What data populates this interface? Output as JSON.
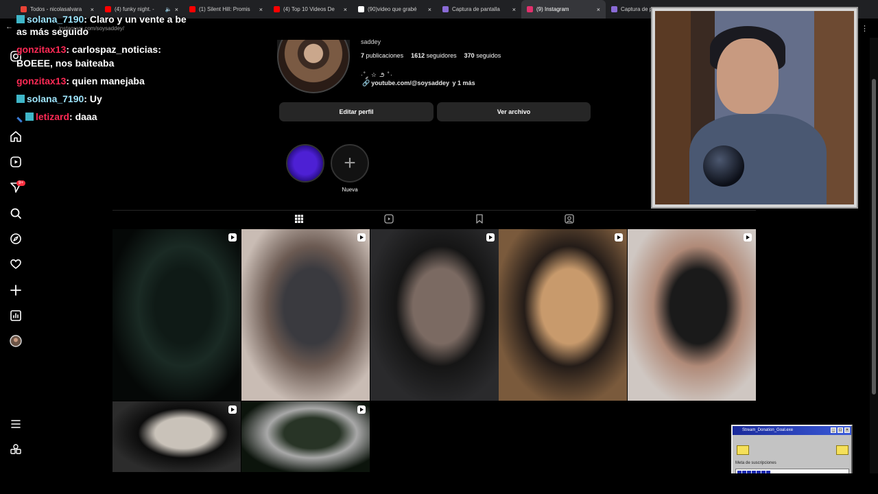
{
  "browser": {
    "tabs": [
      {
        "title": "Todos - nicolasalvara",
        "favicon_color": "#ea4335",
        "active": false
      },
      {
        "title": "(4) funky night. -",
        "favicon_color": "#ff0000",
        "active": false,
        "muted": true
      },
      {
        "title": "(1) Silent Hill: Promis",
        "favicon_color": "#ff0000",
        "active": false
      },
      {
        "title": "(4) Top 10 Videos De",
        "favicon_color": "#ff0000",
        "active": false
      },
      {
        "title": "(90)video que grabé",
        "favicon_color": "#ffffff",
        "active": false
      },
      {
        "title": "Captura de pantalla",
        "favicon_color": "#8a6bd6",
        "active": false
      },
      {
        "title": "(9) Instagram",
        "favicon_color": "#e1306c",
        "active": true
      },
      {
        "title": "Captura de pa",
        "favicon_color": "#8a6bd6",
        "active": false
      }
    ],
    "url": "instagram.com/soysaddey/"
  },
  "chat": {
    "lines": [
      {
        "user": "solana_7190",
        "text": "Claro y un vente a be",
        "user_color": "#9fe6ff"
      },
      {
        "user": "",
        "text": "as más seguido"
      },
      {
        "user": "gonzitax13",
        "text": "carlospaz_noticias:",
        "user_color": "#ff2a55"
      },
      {
        "user": "",
        "text": "BOEEE, nos baiteaba"
      },
      {
        "user": "gonzitax13",
        "text": "quien manejaba",
        "user_color": "#ff2a55"
      },
      {
        "user": "solana_7190",
        "text": "Uy",
        "user_color": "#9fe6ff"
      },
      {
        "user": "letizard",
        "text": "daaa",
        "user_color": "#ff2a55"
      }
    ]
  },
  "sidebar": {
    "badge": "9+",
    "items": [
      "home-icon",
      "reels-icon",
      "messages-icon",
      "search-icon",
      "explore-icon",
      "notifications-icon",
      "create-icon",
      "insights-icon",
      "profile-icon"
    ],
    "bottom": [
      "more-icon",
      "threads-icon"
    ]
  },
  "profile": {
    "username": "saddey",
    "posts_count": "7",
    "posts_label": "publicaciones",
    "followers_count": "1612",
    "followers_label": "seguidores",
    "following_count": "370",
    "following_label": "seguidos",
    "bio": "·˚ ༘ ☆ ౨ ˚·",
    "link_text": "youtube.com/@soysaddey",
    "link_more": "y 1 más",
    "edit_button": "Editar perfil",
    "archive_button": "Ver archivo"
  },
  "highlights": [
    {
      "label": "",
      "color": "#4d20d4"
    },
    {
      "label": "Nueva",
      "is_new": true
    }
  ],
  "profile_tabs": [
    "posts-grid-icon",
    "reels-icon",
    "saved-icon",
    "tagged-icon"
  ],
  "grid": {
    "tiles": [
      {
        "kind": "reel",
        "palette": [
          "#050807",
          "#0f1a16",
          "#1a2a24"
        ]
      },
      {
        "kind": "reel",
        "palette": [
          "#c9bcb4",
          "#3a3a3f",
          "#6b5a52"
        ]
      },
      {
        "kind": "reel",
        "palette": [
          "#2a2a2c",
          "#7b6a62",
          "#151515"
        ]
      },
      {
        "kind": "reel",
        "palette": [
          "#7a5a3c",
          "#c89a6c",
          "#241c18"
        ]
      },
      {
        "kind": "reel",
        "palette": [
          "#cfc7c2",
          "#1a1a1a",
          "#b08a78"
        ]
      },
      {
        "kind": "reel",
        "palette": [
          "#2c2c2c",
          "#c9c2b9",
          "#0c0c0c"
        ]
      },
      {
        "kind": "reel",
        "palette": [
          "#0c140c",
          "#283426",
          "#a8a8a8"
        ]
      }
    ]
  },
  "donation_widget": {
    "title": "Stream_Donation_Goal.exe",
    "meta_label": "Meta de suscripciones",
    "progress_blocks": 7
  }
}
